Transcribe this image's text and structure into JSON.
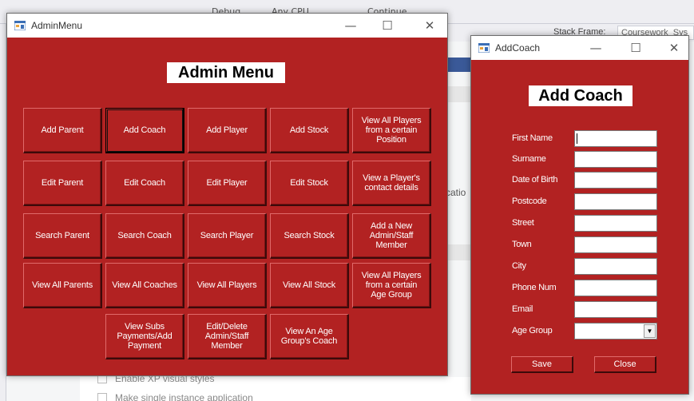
{
  "ide": {
    "toolbar_debug": "Debug",
    "toolbar_cpu": "Any CPU",
    "toolbar_continue": "Continue",
    "stack_frame_label": "Stack Frame:",
    "stack_frame_value": "Coursework_Sys",
    "partial_text": "catio",
    "checkbox_1": "Enable XP visual styles",
    "checkbox_2": "Make single instance application"
  },
  "admin_window": {
    "title": "AdminMenu",
    "heading": "Admin Menu",
    "buttons": [
      "Add Parent",
      "Add Coach",
      "Add Player",
      "Add Stock",
      "View All Players from a certain Position",
      "Edit Parent",
      "Edit Coach",
      "Edit Player",
      "Edit Stock",
      "View a Player's contact details",
      "Search Parent",
      "Search Coach",
      "Search Player",
      "Search Stock",
      "Add a New Admin/Staff Member",
      "View All Parents",
      "View All Coaches",
      "View All Players",
      "View All Stock",
      "View All Players from a certain Age Group",
      "View Subs Payments/Add Payment",
      "Edit/Delete Admin/Staff Member",
      "View An Age Group's Coach"
    ]
  },
  "coach_window": {
    "title": "AddCoach",
    "heading": "Add Coach",
    "fields": [
      "First Name",
      "Surname",
      "Date of Birth",
      "Postcode",
      "Street",
      "Town",
      "City",
      "Phone Num",
      "Email"
    ],
    "age_group_label": "Age Group",
    "age_group_value": "",
    "save_label": "Save",
    "close_label": "Close"
  },
  "window_controls": {
    "minimize": "—",
    "maximize": "☐",
    "close": "✕"
  },
  "colors": {
    "form_background": "#b22222"
  }
}
